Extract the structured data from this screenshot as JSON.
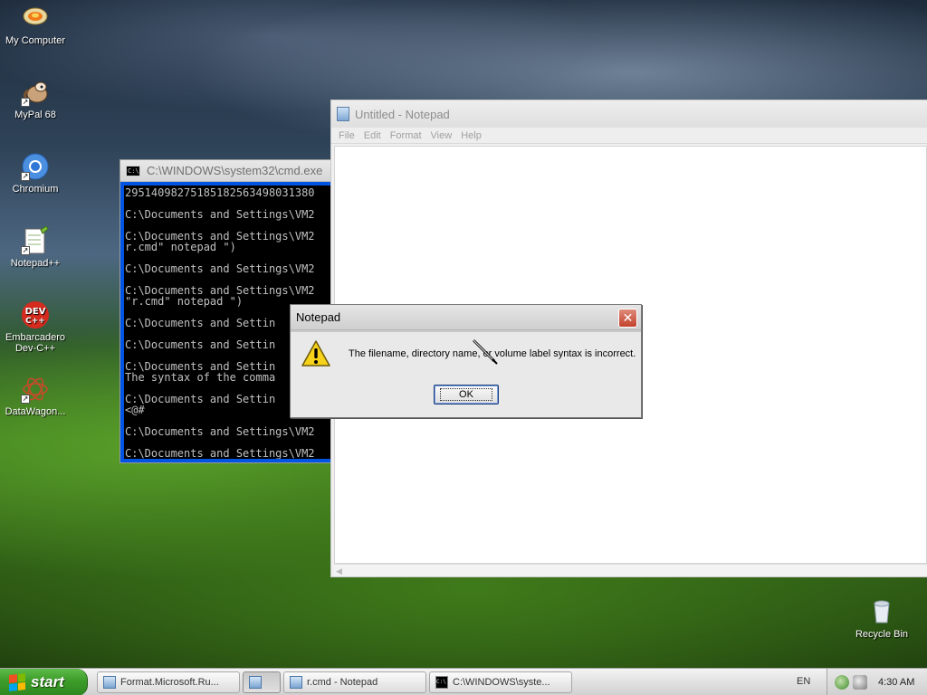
{
  "desktop": {
    "icons": [
      {
        "label": "My Computer"
      },
      {
        "label": "MyPal 68"
      },
      {
        "label": "Chromium"
      },
      {
        "label": "Notepad++"
      },
      {
        "label": "Embarcadero Dev-C++"
      },
      {
        "label": "DataWagon..."
      },
      {
        "label": "Recycle Bin"
      }
    ]
  },
  "cmd": {
    "title": "C:\\WINDOWS\\system32\\cmd.exe",
    "icon_text": "C:\\",
    "output": "29514098275185182563498031380\n\nC:\\Documents and Settings\\VM2\n\nC:\\Documents and Settings\\VM2\nr.cmd\" notepad \")\n\nC:\\Documents and Settings\\VM2\n\nC:\\Documents and Settings\\VM2\n\"r.cmd\" notepad \")\n\nC:\\Documents and Settin\n\nC:\\Documents and Settin\n\nC:\\Documents and Settin\nThe syntax of the comma\n\nC:\\Documents and Settin\n<@#\n\nC:\\Documents and Settings\\VM2\n\nC:\\Documents and Settings\\VM2"
  },
  "notepad": {
    "title": "Untitled - Notepad",
    "menu": [
      "File",
      "Edit",
      "Format",
      "View",
      "Help"
    ]
  },
  "dialog": {
    "title": "Notepad",
    "close_glyph": "✕",
    "message": "The filename, directory name, or volume label syntax is incorrect.",
    "ok_label": "OK"
  },
  "taskbar": {
    "start_label": "start",
    "tasks": [
      {
        "label": "Format.Microsoft.Ru...",
        "active": false
      },
      {
        "label": "",
        "active": true
      },
      {
        "label": "r.cmd - Notepad",
        "active": false
      },
      {
        "label": "C:\\WINDOWS\\syste...",
        "active": false
      }
    ],
    "language": "EN",
    "clock": "4:30 AM"
  }
}
